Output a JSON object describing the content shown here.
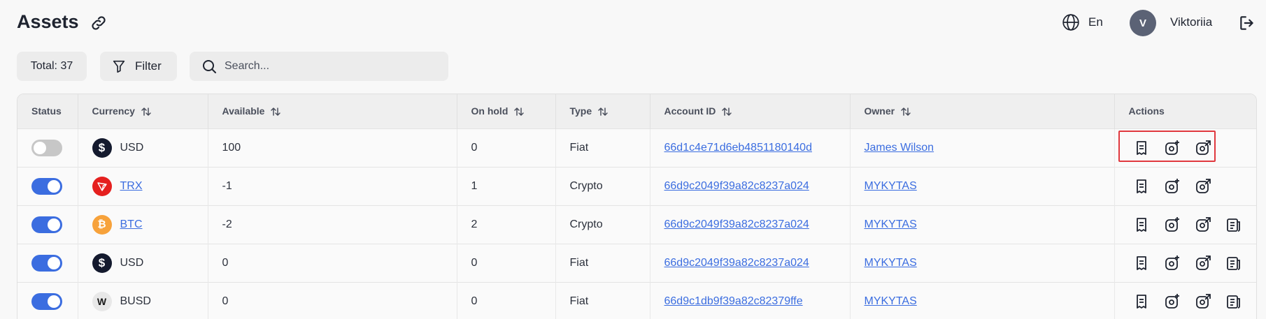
{
  "header": {
    "title": "Assets",
    "language": "En",
    "user_initial": "V",
    "user_name": "Viktoriia"
  },
  "toolbar": {
    "total_label": "Total: 37",
    "filter_label": "Filter",
    "search_placeholder": "Search..."
  },
  "table": {
    "columns": [
      "Status",
      "Currency",
      "Available",
      "On hold",
      "Type",
      "Account ID",
      "Owner",
      "Actions"
    ],
    "rows": [
      {
        "status": "off",
        "currency": "USD",
        "currency_link": false,
        "coin": "usd",
        "available": "100",
        "on_hold": "0",
        "type": "Fiat",
        "account_id": "66d1c4e71d6eb4851180140d",
        "owner": "James Wilson",
        "actions": 3
      },
      {
        "status": "on",
        "currency": "TRX",
        "currency_link": true,
        "coin": "trx",
        "available": "-1",
        "on_hold": "1",
        "type": "Crypto",
        "account_id": "66d9c2049f39a82c8237a024",
        "owner": "MYKYTAS",
        "actions": 3
      },
      {
        "status": "on",
        "currency": "BTC",
        "currency_link": true,
        "coin": "btc",
        "available": "-2",
        "on_hold": "2",
        "type": "Crypto",
        "account_id": "66d9c2049f39a82c8237a024",
        "owner": "MYKYTAS",
        "actions": 4
      },
      {
        "status": "on",
        "currency": "USD",
        "currency_link": false,
        "coin": "usd",
        "available": "0",
        "on_hold": "0",
        "type": "Fiat",
        "account_id": "66d9c2049f39a82c8237a024",
        "owner": "MYKYTAS",
        "actions": 4
      },
      {
        "status": "on",
        "currency": "BUSD",
        "currency_link": false,
        "coin": "busd",
        "available": "0",
        "on_hold": "0",
        "type": "Fiat",
        "account_id": "66d9c1db9f39a82c82379ffe",
        "owner": "MYKYTAS",
        "actions": 4
      }
    ]
  },
  "colors": {
    "accent": "#3b6de0",
    "usd_coin": "#141a2e",
    "trx_coin": "#e5201f",
    "btc_coin": "#f7a23b",
    "busd_coin": "#e8e8e8",
    "highlight": "#e0383e"
  },
  "icons": {
    "action_1": "receipt-icon",
    "action_2": "add-funds-icon",
    "action_3": "send-funds-icon",
    "action_4": "statement-icon"
  }
}
